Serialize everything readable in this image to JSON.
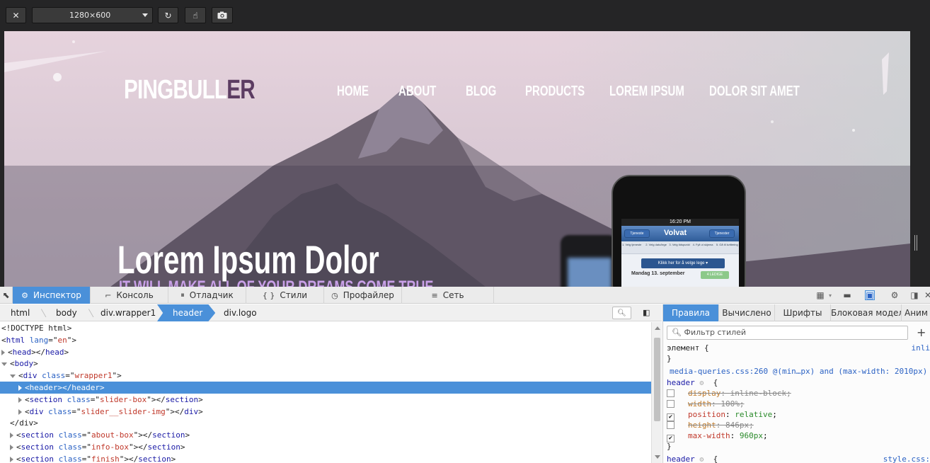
{
  "toolbar": {
    "close_glyph": "✕",
    "size_label": "1280×600",
    "rotate_glyph": "↻",
    "touch_glyph": "☝",
    "screenshot_glyph": "📷"
  },
  "site": {
    "logo_main": "PINGBULL",
    "logo_accent": "ER",
    "nav": [
      "HOME",
      "ABOUT",
      "BLOG",
      "PRODUCTS",
      "LOREM IPSUM",
      "DOLOR SIT AMET"
    ],
    "hero_title": "Lorem Ipsum Dolor",
    "hero_subtitle": "IT WILL MAKE ALL OF YOUR DREAMS COME TRUE",
    "phone": {
      "time": "16:20 PM",
      "left_button": "Tjeneste",
      "brand": "Volvat",
      "right_button": "Tjenester",
      "steps": [
        "1. Velg tjeneste",
        "2. Velg dato/lege",
        "3. Velg tidspunkt",
        "4. Fyll ut skjema",
        "5. Gå til kvittering"
      ],
      "cta": "Klikk her for å velge lege ▾",
      "date": "Mandag 13. september",
      "badge": "4 LEDIGE"
    }
  },
  "devtools": {
    "tabs": [
      {
        "icon": "⚙",
        "label": "Инспектор"
      },
      {
        "icon": "⌐",
        "label": "Консоль"
      },
      {
        "icon": "⏸",
        "label": "Отладчик"
      },
      {
        "icon": "{ }",
        "label": "Стили"
      },
      {
        "icon": "◷",
        "label": "Профайлер"
      },
      {
        "icon": "≡",
        "label": "Сеть"
      }
    ],
    "breadcrumbs": [
      "html",
      "body",
      "div.wrapper1",
      "header",
      "div.logo"
    ],
    "markup_lines": [
      {
        "indent": 0,
        "twisty": "",
        "html": "<!DOCTYPE html>"
      },
      {
        "indent": 0,
        "twisty": "",
        "tag": "html",
        "attr": "lang",
        "val": "en"
      },
      {
        "indent": 0,
        "twisty": "closed",
        "tag": "head",
        "selfclose": true
      },
      {
        "indent": 0,
        "twisty": "open",
        "tag": "body"
      },
      {
        "indent": 1,
        "twisty": "open",
        "tag": "div",
        "attr": "class",
        "val": "wrapper1"
      },
      {
        "indent": 2,
        "twisty": "closed",
        "tag": "header",
        "selfclose": true,
        "selected": true
      },
      {
        "indent": 2,
        "twisty": "closed",
        "tag": "section",
        "attr": "class",
        "val": "slider-box",
        "closeTag": "section"
      },
      {
        "indent": 2,
        "twisty": "closed",
        "tag": "div",
        "attr": "class",
        "val": "slider__slider-img",
        "closeTag": "div"
      },
      {
        "indent": 1,
        "twisty": "",
        "html": "</div>"
      },
      {
        "indent": 1,
        "twisty": "closed",
        "tag": "section",
        "attr": "class",
        "val": "about-box",
        "closeTag": "section"
      },
      {
        "indent": 1,
        "twisty": "closed",
        "tag": "section",
        "attr": "class",
        "val": "info-box",
        "closeTag": "section"
      },
      {
        "indent": 1,
        "twisty": "closed",
        "tag": "section",
        "attr": "class",
        "val": "finish",
        "closeTag": "section"
      }
    ],
    "side_tabs": [
      "Правила",
      "Вычислено",
      "Шрифты",
      "Блоковая модель",
      "Аним"
    ],
    "filter_placeholder": "Фильтр стилей",
    "rules": {
      "element_selector": "элемент {",
      "element_source": "inli",
      "close_brace": "}",
      "media_line": "media-queries.css:260 @(min…px) and (max-width: 2010px)",
      "header_selector": "header",
      "props": [
        {
          "name": "display",
          "value": "inline-block",
          "checked": false,
          "struck": true
        },
        {
          "name": "width",
          "value": "100%",
          "checked": false,
          "struck": true
        },
        {
          "name": "position",
          "value": "relative",
          "checked": true,
          "struck": false
        },
        {
          "name": "height",
          "value": "846px",
          "checked": false,
          "struck": true
        },
        {
          "name": "max-width",
          "value": "960px",
          "checked": true,
          "struck": false
        }
      ],
      "second_selector": "header",
      "second_source": "style.css:"
    }
  }
}
